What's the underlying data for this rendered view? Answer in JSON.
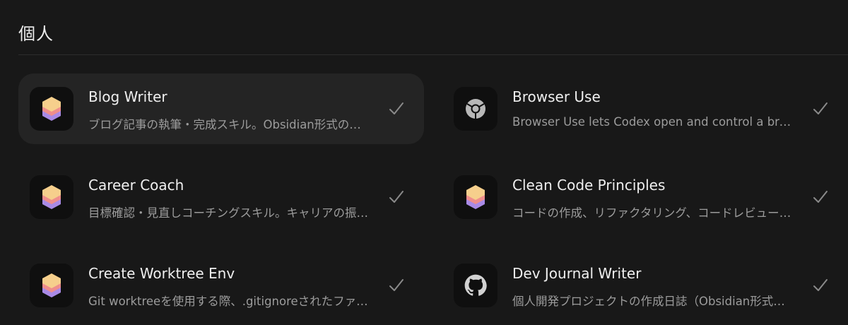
{
  "section": {
    "title": "個人"
  },
  "skills": [
    {
      "name": "Blog Writer",
      "description": "ブログ記事の執筆・完成スキル。Obsidian形式のMarkdownで記事を作成します",
      "icon": "skill-stack-icon",
      "enabled": true,
      "highlighted": true
    },
    {
      "name": "Browser Use",
      "description": "Browser Use lets Codex open and control a browser",
      "icon": "chrome-icon",
      "enabled": true,
      "highlighted": false
    },
    {
      "name": "Career Coach",
      "description": "目標確認・見直しコーチングスキル。キャリアの振り返りを支援します",
      "icon": "skill-stack-icon",
      "enabled": true,
      "highlighted": false
    },
    {
      "name": "Clean Code Principles",
      "description": "コードの作成、リファクタリング、コードレビューの原則",
      "icon": "skill-stack-icon",
      "enabled": true,
      "highlighted": false
    },
    {
      "name": "Create Worktree Env",
      "description": "Git worktreeを使用する際、.gitignoreされたファイルをコピーします",
      "icon": "skill-stack-icon",
      "enabled": true,
      "highlighted": false
    },
    {
      "name": "Dev Journal Writer",
      "description": "個人開発プロジェクトの作成日誌（Obsidian形式）を書きます",
      "icon": "github-icon",
      "enabled": true,
      "highlighted": false
    }
  ],
  "colors": {
    "background": "#181818",
    "card_highlight": "#242424",
    "stack_top": "#f6cf8c",
    "stack_mid": "#ef8e8c",
    "stack_bottom": "#a98ae6"
  }
}
